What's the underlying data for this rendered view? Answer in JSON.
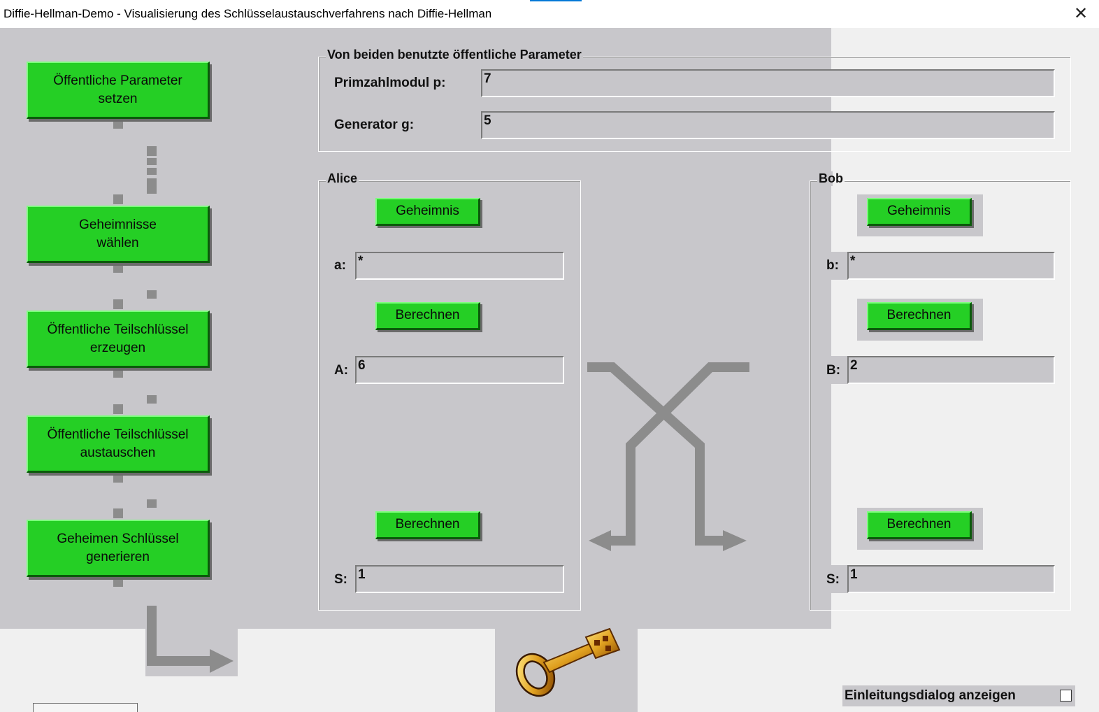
{
  "window": {
    "title": "Diffie-Hellman-Demo - Visualisierung des Schlüsselaustauschverfahrens nach Diffie-Hellman",
    "close_glyph": "✕"
  },
  "steps": [
    {
      "label": "Öffentliche Parameter\nsetzen"
    },
    {
      "label": "Geheimnisse\nwählen"
    },
    {
      "label": "Öffentliche Teilschlüssel\nerzeugen"
    },
    {
      "label": "Öffentliche Teilschlüssel\naustauschen"
    },
    {
      "label": "Geheimen Schlüssel\ngenerieren"
    }
  ],
  "params": {
    "legend": "Von beiden benutzte öffentliche Parameter",
    "p_label": "Primzahlmodul p:",
    "p_value": "7",
    "g_label": "Generator g:",
    "g_value": "5"
  },
  "alice": {
    "legend": "Alice",
    "secret_button": "Geheimnis",
    "a_label": "a:",
    "a_value": "*",
    "compute_button": "Berechnen",
    "A_label": "A:",
    "A_value": "6",
    "key_button": "Berechnen",
    "S_label": "S:",
    "S_value": "1"
  },
  "bob": {
    "legend": "Bob",
    "secret_button": "Geheimnis",
    "b_label": "b:",
    "b_value": "*",
    "compute_button": "Berechnen",
    "B_label": "B:",
    "B_value": "2",
    "key_button": "Berechnen",
    "S_label": "S:",
    "S_value": "1"
  },
  "footer": {
    "intro_checkbox_label": "Einleitungsdialog anzeigen",
    "intro_checked": false
  },
  "colors": {
    "button_green": "#25cf25",
    "panel_gray": "#c8c7cb",
    "arrow_gray": "#8c8c8c"
  }
}
